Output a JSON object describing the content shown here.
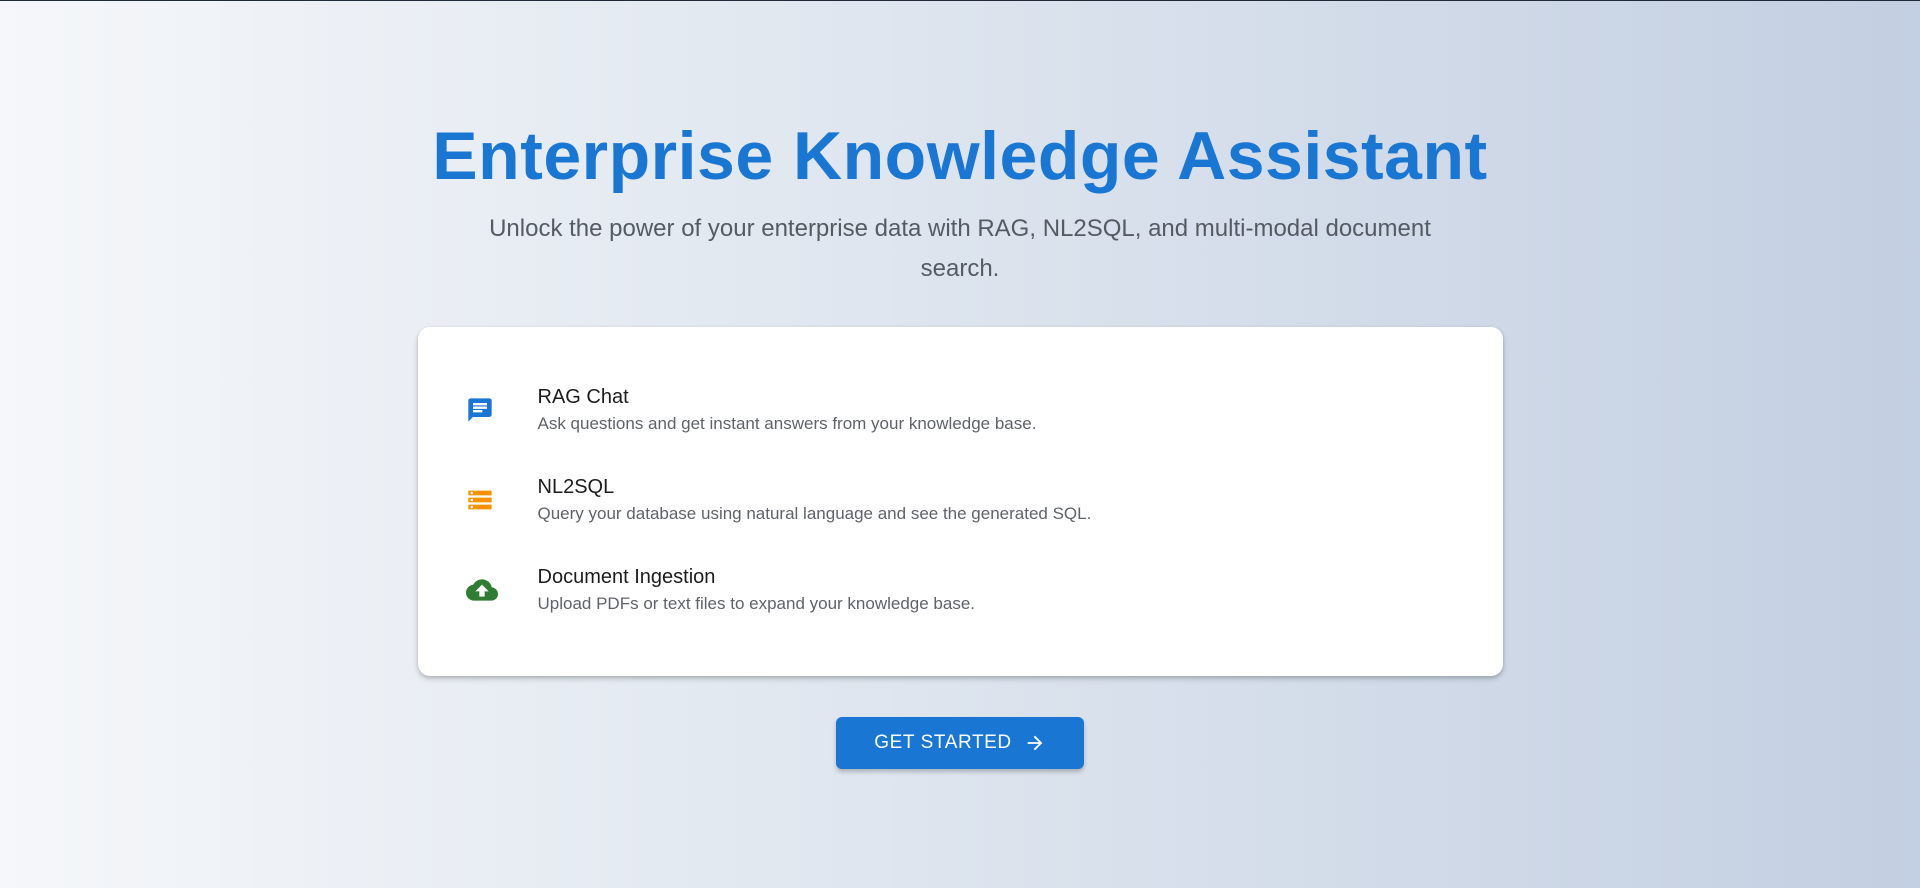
{
  "hero": {
    "title": "Enterprise Knowledge Assistant",
    "subtitle": "Unlock the power of your enterprise data with RAG, NL2SQL, and multi-modal document search."
  },
  "features": [
    {
      "icon": "chat-icon",
      "icon_color": "#1976d2",
      "title": "RAG Chat",
      "description": "Ask questions and get instant answers from your knowledge base."
    },
    {
      "icon": "storage-icon",
      "icon_color": "#f59300",
      "title": "NL2SQL",
      "description": "Query your database using natural language and see the generated SQL."
    },
    {
      "icon": "cloud-upload-icon",
      "icon_color": "#2e7d32",
      "title": "Document Ingestion",
      "description": "Upload PDFs or text files to expand your knowledge base."
    }
  ],
  "cta": {
    "label": "GET STARTED",
    "icon": "arrow-right-icon"
  },
  "colors": {
    "primary": "#1976d2",
    "background_start": "#f5f7fa",
    "background_end": "#c3cfe2"
  }
}
